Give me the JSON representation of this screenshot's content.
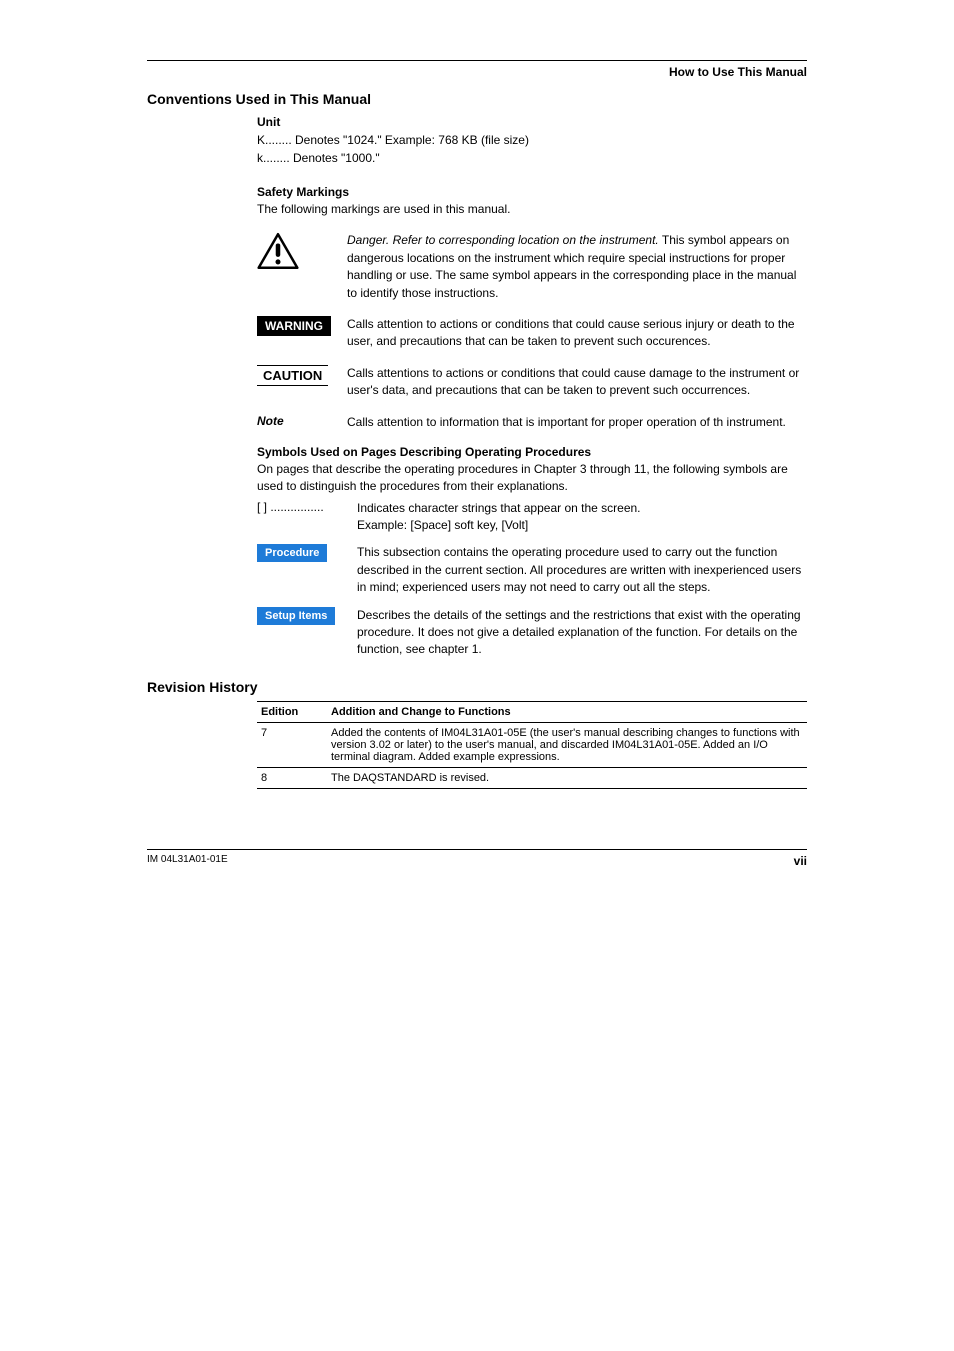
{
  "header": {
    "breadcrumb": "How to Use This Manual"
  },
  "conventions": {
    "title": "Conventions Used in This Manual",
    "unit": {
      "heading": "Unit",
      "lines": [
        "K........  Denotes \"1024.\"  Example: 768 KB (file size)",
        "k........  Denotes \"1000.\""
      ]
    },
    "safety": {
      "heading": "Safety Markings",
      "intro": "The following markings are used in this manual.",
      "danger": {
        "first_sentence": "Danger.  Refer to corresponding location on the instrument.",
        "rest": "This symbol appears on dangerous locations on the instrument which require special instructions for proper handling or use.  The same symbol appears in the corresponding place in the manual to identify those instructions."
      },
      "warning": {
        "label": "WARNING",
        "text": "Calls attention to actions or conditions that could cause serious injury or death to the user, and precautions that can be taken to prevent such occurences."
      },
      "caution": {
        "label": "CAUTION",
        "text": "Calls attentions to actions or conditions that could cause damage to the instrument or user's data, and precautions that can be taken to prevent such occurrences."
      },
      "note": {
        "label": "Note",
        "text": "Calls attention to information that is important for proper operation of th instrument."
      }
    },
    "symbols_procedures": {
      "heading": "Symbols Used on Pages Describing Operating Procedures",
      "intro": "On pages that describe the operating procedures in Chapter 3 through 11, the following symbols are used to distinguish the procedures from their explanations.",
      "brackets": {
        "left": "[   ] ................",
        "line1": "Indicates character strings that appear on the screen.",
        "line2": "Example: [Space] soft key, [Volt]"
      },
      "procedure": {
        "label": "Procedure",
        "text": "This subsection contains the operating procedure used to carry out the function described in the current section.  All procedures are written with inexperienced users in mind; experienced users may not need to carry out all the steps."
      },
      "setup": {
        "label": "Setup Items",
        "text": "Describes the details of the settings and the restrictions that exist with the operating procedure.  It does not give a detailed explanation of the function.  For details on the function, see chapter 1."
      }
    }
  },
  "revision": {
    "title": "Revision History",
    "headers": {
      "edition": "Edition",
      "change": "Addition and Change to Functions"
    },
    "rows": [
      {
        "edition": "7",
        "change": "Added the contents of IM04L31A01-05E (the user's manual describing changes to functions with version 3.02 or later) to the user's manual, and discarded IM04L31A01-05E. Added an I/O terminal diagram. Added example expressions."
      },
      {
        "edition": "8",
        "change": "The DAQSTANDARD is revised."
      }
    ]
  },
  "footer": {
    "left": "IM  04L31A01-01E",
    "right": "vii"
  }
}
